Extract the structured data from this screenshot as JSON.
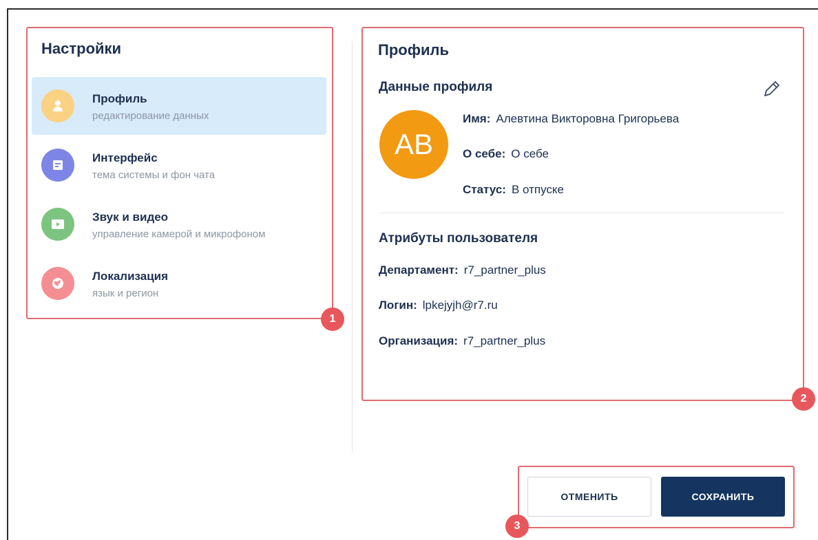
{
  "settings": {
    "title": "Настройки",
    "items": [
      {
        "label": "Профиль",
        "subtitle": "редактирование данных",
        "icon": "user-icon",
        "color": "#fbd283"
      },
      {
        "label": "Интерфейс",
        "subtitle": "тема системы и фон чата",
        "icon": "interface-icon",
        "color": "#7d86e6"
      },
      {
        "label": "Звук и видео",
        "subtitle": "управление камерой и микрофоном",
        "icon": "video-icon",
        "color": "#7cc47f"
      },
      {
        "label": "Локализация",
        "subtitle": "язык и регион",
        "icon": "globe-icon",
        "color": "#f58e93"
      }
    ]
  },
  "profile": {
    "title": "Профиль",
    "data_title": "Данные профиля",
    "avatar_initials": "AB",
    "avatar_color": "#f29a12",
    "name_label": "Имя:",
    "name_value": "Алевтина Викторовна Григорьева",
    "about_label": "О себе:",
    "about_value": "О себе",
    "status_label": "Статус:",
    "status_value": "В отпуске",
    "attributes_title": "Атрибуты пользователя",
    "department_label": "Департамент:",
    "department_value": "r7_partner_plus",
    "login_label": "Логин:",
    "login_value": "lpkejyjh@r7.ru",
    "org_label": "Организация:",
    "org_value": "r7_partner_plus"
  },
  "buttons": {
    "cancel": "ОТМЕНИТЬ",
    "save": "СОХРАНИТЬ"
  },
  "callouts": [
    "1",
    "2",
    "3"
  ],
  "colors": {
    "callout": "#e06b72",
    "badge": "#e8575c",
    "active_item": "#d7ebfa",
    "save_button": "#153560"
  }
}
